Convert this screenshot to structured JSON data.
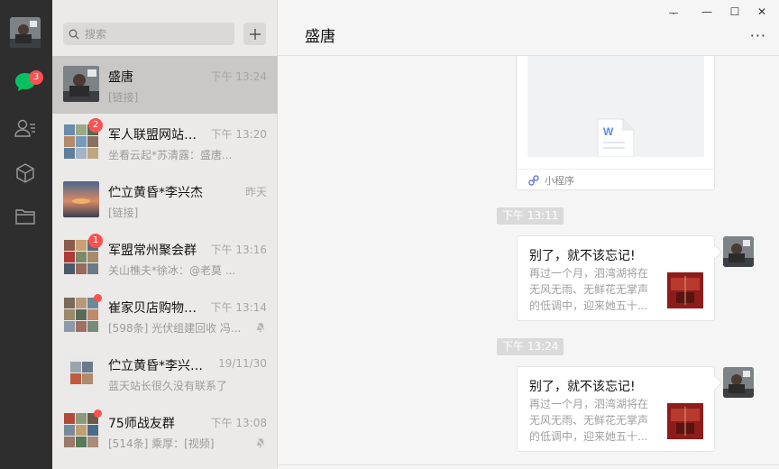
{
  "search": {
    "placeholder": "搜索"
  },
  "nav": {
    "chat_badge": "3"
  },
  "conversations": [
    {
      "name": "盛唐",
      "time": "下午 13:24",
      "preview": "[链接]"
    },
    {
      "name": "军人联盟网站主...",
      "time": "下午 13:20",
      "preview": "坐看云起*苏清露：盛唐...",
      "badge": "2"
    },
    {
      "name": "伫立黄昏*李兴杰",
      "time": "昨天",
      "preview": "[链接]"
    },
    {
      "name": "军盟常州聚会群",
      "time": "下午 13:16",
      "preview": "关山樵夫*徐冰：@老莫 ...",
      "badge": "1"
    },
    {
      "name": "崔家贝店购物超市",
      "time": "下午 13:14",
      "preview": "[598条] 光伏组建回收 冯..."
    },
    {
      "name": "伫立黄昏*李兴杰...",
      "time": "19/11/30",
      "preview": "蓝天站长很久没有联系了"
    },
    {
      "name": "75师战友群",
      "time": "下午 13:08",
      "preview": "[514条] 乘厚：[视频]"
    }
  ],
  "chat": {
    "title": "盛唐",
    "more": "···",
    "window_controls": {
      "pin": "ᅮ",
      "minimize": "—",
      "maximize": "☐",
      "close": "✕"
    },
    "card_footer": "小程序",
    "messages": [
      {
        "stamp": "下午 13:11",
        "title": "别了，就不该忘记!",
        "lines": [
          "再过一个月，泗湾湖将在",
          "无风无雨、无鲜花无掌声",
          "的低调中，迎来她五十..."
        ]
      },
      {
        "stamp": "下午 13:24",
        "title": "别了，就不该忘记!",
        "lines": [
          "再过一个月，泗湾湖将在",
          "无风无雨、无鲜花无掌声",
          "的低调中，迎来她五十..."
        ]
      }
    ]
  },
  "colors": {
    "accent": "#07c160",
    "badge": "#fa5151",
    "rail": "#2e2e2e"
  }
}
